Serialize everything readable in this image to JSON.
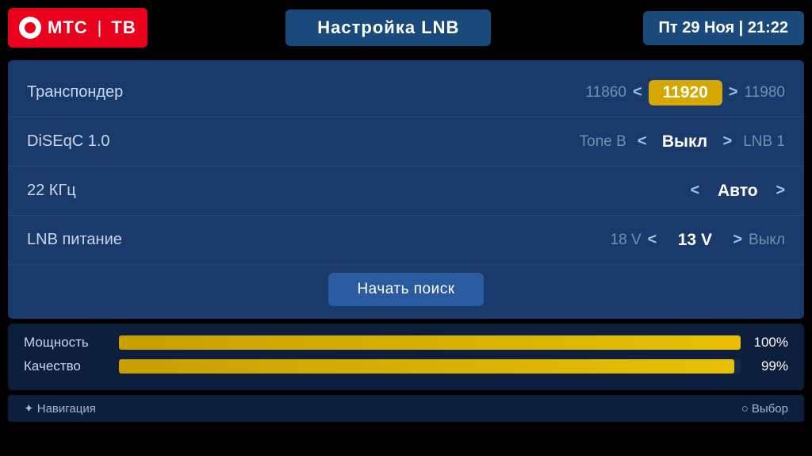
{
  "header": {
    "logo_brand": "МТС",
    "logo_divider": "|",
    "logo_service": "ТВ",
    "title": "Настройка  LNB",
    "datetime": "Пт  29  Ноя  |  21:22"
  },
  "rows": [
    {
      "label": "Транспондер",
      "left_value": "11860",
      "selected_value": "11920",
      "right_value": "11980",
      "type": "transponder"
    },
    {
      "label": "DiSEqC 1.0",
      "tone_label": "Tone  В",
      "selected_value": "Выкл",
      "right_value": "LNB 1",
      "type": "diseqc"
    },
    {
      "label": "22 КГц",
      "selected_value": "Авто",
      "type": "khz"
    },
    {
      "label": "LNB питание",
      "left_value": "18 V",
      "selected_value": "13 V",
      "right_value": "Выкл",
      "type": "lnb_power"
    }
  ],
  "search_button": "Начать  поиск",
  "signal": {
    "strength_label": "Мощность",
    "strength_pct": "100%",
    "strength_val": 100,
    "quality_label": "Качество",
    "quality_pct": "99%",
    "quality_val": 99
  },
  "nav": {
    "navigation_label": "✦ Навигация",
    "select_label": "○ Выбор"
  }
}
